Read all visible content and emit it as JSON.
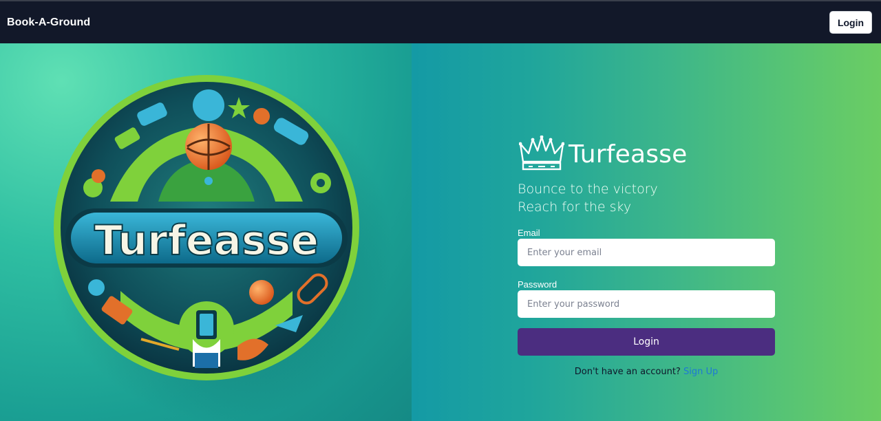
{
  "navbar": {
    "brand": "Book-A-Ground",
    "login_label": "Login"
  },
  "hero": {
    "logo_text": "Turfeasse"
  },
  "login_panel": {
    "brand_name": "Turfeasse",
    "tagline_1": "Bounce to the victory",
    "tagline_2": "Reach for the sky",
    "email_label": "Email",
    "email_placeholder": "Enter your email",
    "password_label": "Password",
    "password_placeholder": "Enter your password",
    "submit_label": "Login",
    "signup_prompt": "Don't have an account?",
    "signup_link": "Sign Up"
  },
  "colors": {
    "navbar_bg": "#121829",
    "submit_bg": "#4b2d80",
    "link": "#1d78d6",
    "panel_gradient_start": "#149aa5",
    "panel_gradient_end": "#6bcd63"
  },
  "icons": [
    "crown-icon"
  ]
}
